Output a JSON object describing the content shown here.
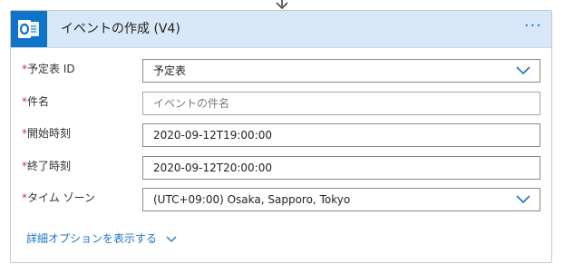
{
  "action": {
    "title": "イベントの作成 (V4)",
    "icon": "outlook-icon",
    "more_label": "···",
    "accent": "#0f73c7",
    "header_bg": "#d8e8f8"
  },
  "fields": [
    {
      "label": "予定表 ID",
      "value": "予定表",
      "placeholder": "",
      "type": "dropdown"
    },
    {
      "label": "件名",
      "value": "",
      "placeholder": "イベントの件名",
      "type": "text"
    },
    {
      "label": "開始時刻",
      "value": "2020-09-12T19:00:00",
      "placeholder": "",
      "type": "text"
    },
    {
      "label": "終了時刻",
      "value": "2020-09-12T20:00:00",
      "placeholder": "",
      "type": "text"
    },
    {
      "label": "タイム ゾーン",
      "value": "(UTC+09:00) Osaka, Sapporo, Tokyo",
      "placeholder": "",
      "type": "dropdown"
    }
  ],
  "required_marker": "*",
  "advanced_options": {
    "label": "詳細オプションを表示する",
    "icon": "chevron-down-icon"
  }
}
